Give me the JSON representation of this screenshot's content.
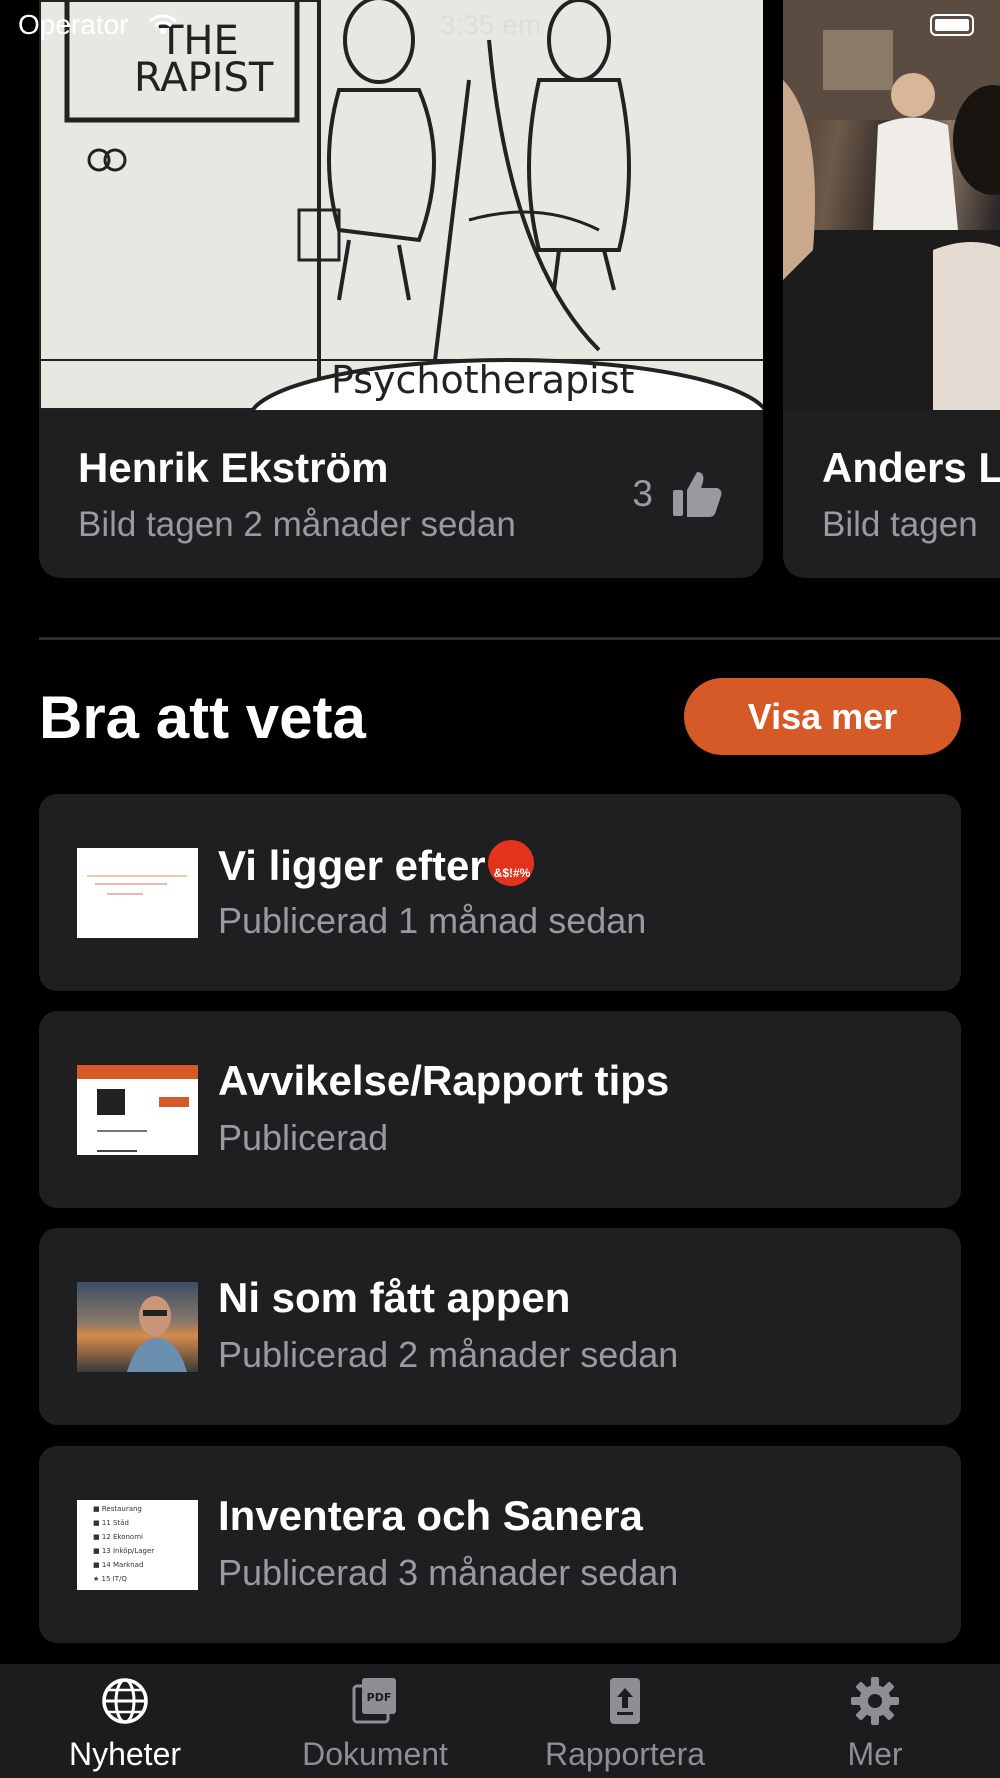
{
  "status_bar": {
    "carrier": "Operator",
    "time": "3:35 em"
  },
  "carousel": [
    {
      "image_text": [
        "THE",
        "RAPIST",
        "Psychotherapist"
      ],
      "author": "Henrik Ekström",
      "meta": "Bild tagen 2 månader sedan",
      "likes": "3"
    },
    {
      "author": "Anders L",
      "meta": "Bild tagen"
    }
  ],
  "section": {
    "title": "Bra att veta",
    "more_button": "Visa mer"
  },
  "items": [
    {
      "title": "Vi ligger efter",
      "emoji_text": "&$!#%",
      "subtitle": "Publicerad 1 månad sedan"
    },
    {
      "title": "Avvikelse/Rapport tips",
      "subtitle": "Publicerad"
    },
    {
      "title": "Ni som fått appen",
      "subtitle": "Publicerad 2 månader sedan"
    },
    {
      "title": "Inventera och Sanera",
      "subtitle": "Publicerad 3 månader sedan",
      "thumb_lines": [
        "Restaurang",
        "11 Städ",
        "12 Ekonomi",
        "13 Inköp/Lager",
        "14 Marknad",
        "15 IT/Q"
      ]
    }
  ],
  "tabs": [
    {
      "label": "Nyheter",
      "icon": "globe-icon",
      "active": true
    },
    {
      "label": "Dokument",
      "icon": "pdf-icon",
      "active": false
    },
    {
      "label": "Rapportera",
      "icon": "upload-icon",
      "active": false
    },
    {
      "label": "Mer",
      "icon": "gear-icon",
      "active": false
    }
  ],
  "colors": {
    "accent": "#d65a27",
    "card": "#1f1f21",
    "muted": "#9a9a9e",
    "tabbar": "#1c1c1e"
  }
}
